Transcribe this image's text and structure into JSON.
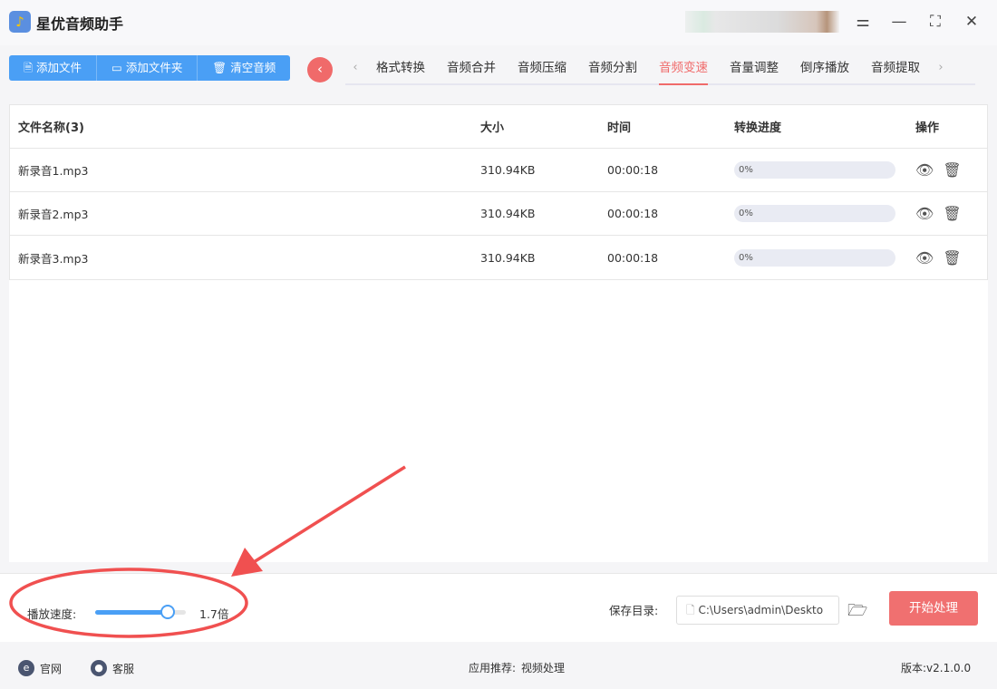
{
  "app": {
    "title": "星优音频助手"
  },
  "toolbar": {
    "add_file": "添加文件",
    "add_folder": "添加文件夹",
    "clear": "清空音频"
  },
  "tabs": [
    "格式转换",
    "音频合并",
    "音频压缩",
    "音频分割",
    "音频变速",
    "音量调整",
    "倒序播放",
    "音频提取"
  ],
  "active_tab": "音频变速",
  "table": {
    "headers": [
      "文件名称(3)",
      "大小",
      "时间",
      "转换进度",
      "操作"
    ],
    "rows": [
      {
        "name": "新录音1.mp3",
        "size": "310.94KB",
        "time": "00:00:18",
        "progress": "0%"
      },
      {
        "name": "新录音2.mp3",
        "size": "310.94KB",
        "time": "00:00:18",
        "progress": "0%"
      },
      {
        "name": "新录音3.mp3",
        "size": "310.94KB",
        "time": "00:00:18",
        "progress": "0%"
      }
    ]
  },
  "settings": {
    "speed_label": "播放速度:",
    "speed_value": "1.7倍",
    "speed": 1.7,
    "speed_min": 0.5,
    "speed_max": 2.0,
    "save_label": "保存目录:",
    "save_path": "C:\\Users\\admin\\Deskto",
    "start": "开始处理"
  },
  "footer": {
    "website": "官网",
    "support": "客服",
    "recommend": "应用推荐:",
    "recommend_link": "视频处理",
    "version": "版本:v2.1.0.0"
  },
  "colors": {
    "accent": "#4a9ff5",
    "danger": "#f06a6a",
    "annotation": "#f05050"
  }
}
